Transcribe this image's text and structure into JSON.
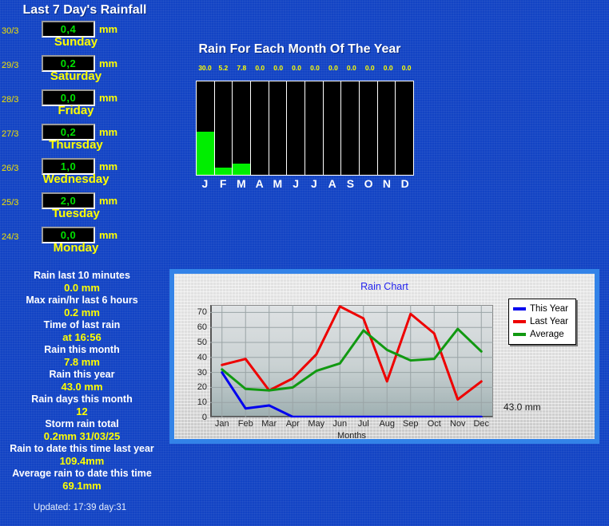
{
  "theme": {
    "background": "#1344c4",
    "accent_yellow": "#ffff00",
    "accent_white": "#ffffff",
    "led_green": "#00e000",
    "bar_green": "#00ee00",
    "card_blue": "#3383e8"
  },
  "week_panel": {
    "title": "Last 7 Day's Rainfall",
    "unit": "mm",
    "days": [
      {
        "date": "30/3",
        "value": "0,4",
        "name": "Sunday"
      },
      {
        "date": "29/3",
        "value": "0,2",
        "name": "Saturday"
      },
      {
        "date": "28/3",
        "value": "0,0",
        "name": "Friday"
      },
      {
        "date": "27/3",
        "value": "0,2",
        "name": "Thursday"
      },
      {
        "date": "26/3",
        "value": "1,0",
        "name": "Wednesday"
      },
      {
        "date": "25/3",
        "value": "2,0",
        "name": "Tuesday"
      },
      {
        "date": "24/3",
        "value": "0,0",
        "name": "Monday"
      }
    ]
  },
  "stats": {
    "rows": [
      {
        "label": "Rain last 10 minutes",
        "value": "0.0 mm"
      },
      {
        "label": "Max rain/hr last 6 hours",
        "value": "0.2 mm"
      },
      {
        "label": "Time of last rain",
        "value": "at 16:56"
      },
      {
        "label": "Rain this month",
        "value": "7.8 mm"
      },
      {
        "label": "Rain this year",
        "value": "43.0 mm"
      },
      {
        "label": "Rain days this month",
        "value": "12"
      },
      {
        "label": "Storm rain total",
        "value": "0.2mm 31/03/25"
      },
      {
        "label": "Rain to date this time last year",
        "value": "109.4mm"
      },
      {
        "label": "Average rain to date this time",
        "value": "69.1mm"
      }
    ],
    "updated": "Updated: 17:39 day:31"
  },
  "chart_data": [
    {
      "id": "monthly-bars",
      "type": "bar",
      "title": "Rain For Each Month Of The Year",
      "xlabel": "",
      "ylabel": "",
      "ylim": [
        0,
        65
      ],
      "grid": false,
      "categories": [
        "J",
        "F",
        "M",
        "A",
        "M",
        "J",
        "J",
        "A",
        "S",
        "O",
        "N",
        "D"
      ],
      "values": [
        30.0,
        5.2,
        7.8,
        0.0,
        0.0,
        0.0,
        0.0,
        0.0,
        0.0,
        0.0,
        0.0,
        0.0
      ],
      "value_labels": [
        "30.0",
        "5.2",
        "7.8",
        "0.0",
        "0.0",
        "0.0",
        "0.0",
        "0.0",
        "0.0",
        "0.0",
        "0.0",
        "0.0"
      ],
      "bar_color": "#00ee00",
      "plot_background": "#000000"
    },
    {
      "id": "rain-chart",
      "type": "line",
      "title": "Rain Chart",
      "xlabel": "Months",
      "ylabel": "",
      "ylim": [
        0,
        75
      ],
      "yticks": [
        0,
        10,
        20,
        30,
        40,
        50,
        60,
        70
      ],
      "grid": true,
      "legend_position": "top-right",
      "annotation": "43.0 mm",
      "x": [
        "Jan",
        "Feb",
        "Mar",
        "Apr",
        "May",
        "Jun",
        "Jul",
        "Aug",
        "Sep",
        "Oct",
        "Nov",
        "Dec"
      ],
      "series": [
        {
          "name": "This Year",
          "color": "#0000ee",
          "values": [
            30,
            6,
            8,
            0.4,
            0.4,
            0.4,
            0.4,
            0.4,
            0.4,
            0.4,
            0.4,
            0.4
          ]
        },
        {
          "name": "Last Year",
          "color": "#ee0000",
          "values": [
            35,
            39,
            18,
            26,
            42,
            74,
            66,
            24,
            69,
            56,
            12,
            24
          ]
        },
        {
          "name": "Average",
          "color": "#119911",
          "values": [
            32,
            19,
            18,
            20,
            31,
            36,
            58,
            45,
            38,
            39,
            59,
            44
          ]
        }
      ]
    }
  ]
}
